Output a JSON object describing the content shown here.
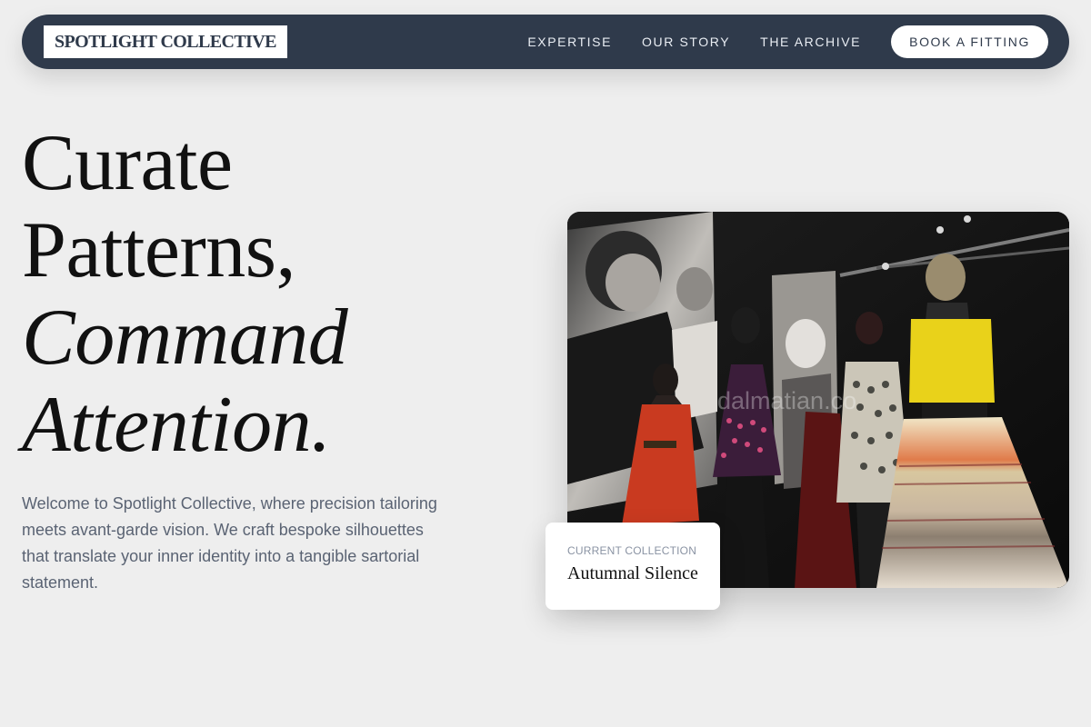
{
  "brand": {
    "logo": "SPOTLIGHT COLLECTIVE"
  },
  "nav": {
    "links": [
      "EXPERTISE",
      "OUR STORY",
      "THE ARCHIVE"
    ],
    "cta": "BOOK A FITTING"
  },
  "hero": {
    "title_lines": [
      "Curate",
      "Patterns,",
      "Command",
      "Attention."
    ],
    "intro": "Welcome to Spotlight Collective, where precision tailoring meets avant-garde vision. We craft bespoke silhouettes that translate your inner identity into a tangible sartorial statement.",
    "image": {
      "subject": "fashion-exhibition-mannequins",
      "watermark": "dalmatian.co"
    }
  },
  "collection_card": {
    "kicker": "Current Collection",
    "title": "Autumnal Silence"
  },
  "colors": {
    "page_bg": "#eeeeee",
    "nav_bg": "#2f3a4b",
    "text_dark": "#111111",
    "text_muted": "#5a6373"
  }
}
